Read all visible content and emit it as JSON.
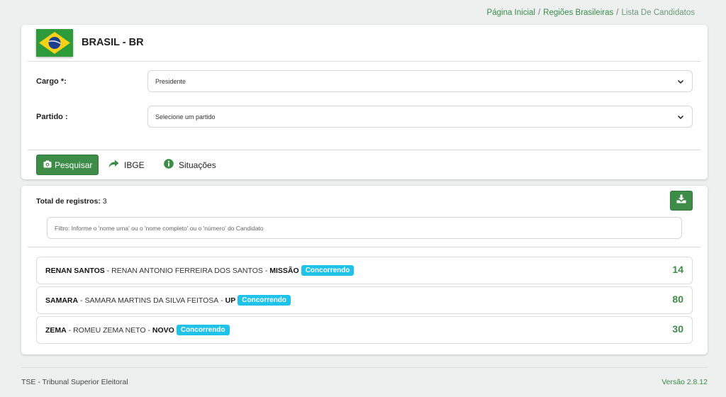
{
  "breadcrumb": {
    "home": "Página Inicial",
    "regions": "Regiões Brasileiras",
    "current": "Lista De Candidatos",
    "separator": "/"
  },
  "header": {
    "country": "BRASIL - BR",
    "flag_icon": "brazil-flag"
  },
  "form": {
    "cargo_label": "Cargo *:",
    "cargo_value": "Presidente",
    "partido_label": "Partido :",
    "partido_value": "Selecione um partido"
  },
  "toolbar": {
    "search_label": "Pesquisar",
    "ibge_label": "IBGE",
    "situacoes_label": "Situações"
  },
  "results": {
    "total_label": "Total de registros:",
    "total_value": "3",
    "filter_placeholder": "Filtro: Informe o 'nome urna' ou o 'nome completo' ou o 'número' do Candidato",
    "candidates": [
      {
        "urn_name": "RENAN SANTOS",
        "sep1": " - ",
        "full_name": "RENAN ANTONIO FERREIRA DOS SANTOS",
        "sep2": " - ",
        "party": "MISSÃO",
        "status": "Concorrendo",
        "number": "14"
      },
      {
        "urn_name": "SAMARA",
        "sep1": " - ",
        "full_name": "SAMARA MARTINS DA SILVA FEITOSA",
        "sep2": " - ",
        "party": "UP",
        "status": "Concorrendo",
        "number": "80"
      },
      {
        "urn_name": "ZEMA",
        "sep1": " - ",
        "full_name": "ROMEU ZEMA NETO",
        "sep2": " - ",
        "party": "NOVO",
        "status": "Concorrendo",
        "number": "30"
      }
    ]
  },
  "footer": {
    "left": "TSE - Tribunal Superior Eleitoral",
    "version": "Versão 2.8.12"
  },
  "colors": {
    "accent_green": "#3d8c47",
    "badge_cyan": "#1fc3ea",
    "background": "#eef0f0"
  }
}
